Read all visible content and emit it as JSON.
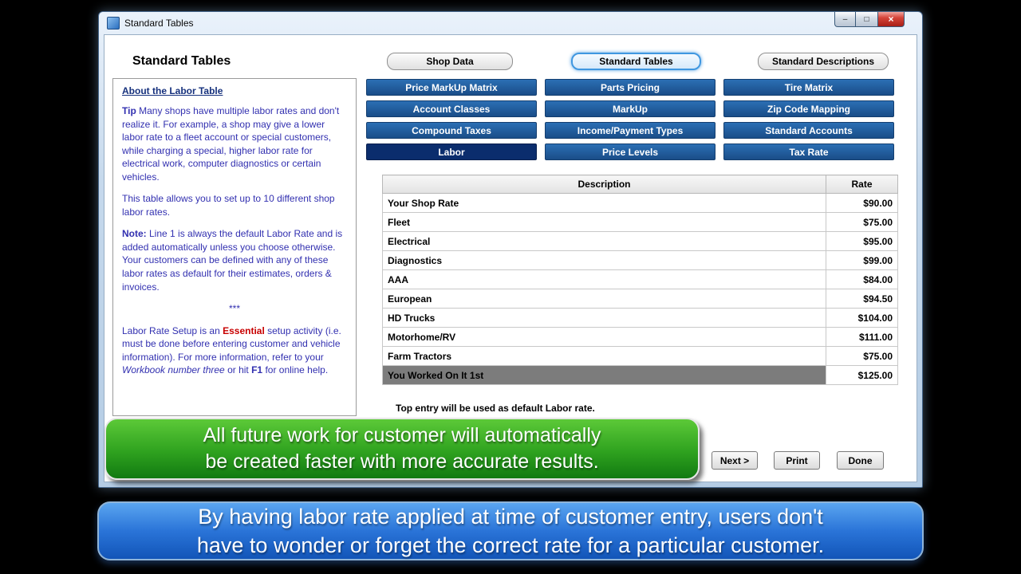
{
  "window": {
    "title": "Standard Tables",
    "heading": "Standard Tables",
    "controls": {
      "minimize": "–",
      "maximize": "□",
      "close": "×"
    }
  },
  "top_tabs": [
    {
      "label": "Shop Data",
      "selected": false
    },
    {
      "label": "Standard Tables",
      "selected": true
    },
    {
      "label": "Standard Descriptions",
      "selected": false
    }
  ],
  "grid_buttons": [
    {
      "label": "Price MarkUp Matrix",
      "selected": false
    },
    {
      "label": "Parts Pricing",
      "selected": false
    },
    {
      "label": "Tire Matrix",
      "selected": false
    },
    {
      "label": "Account Classes",
      "selected": false
    },
    {
      "label": "MarkUp",
      "selected": false
    },
    {
      "label": "Zip Code Mapping",
      "selected": false
    },
    {
      "label": "Compound Taxes",
      "selected": false
    },
    {
      "label": "Income/Payment Types",
      "selected": false
    },
    {
      "label": "Standard Accounts",
      "selected": false
    },
    {
      "label": "Labor",
      "selected": true
    },
    {
      "label": "Price Levels",
      "selected": false
    },
    {
      "label": "Tax Rate",
      "selected": false
    }
  ],
  "about_panel": {
    "header": "About the Labor Table",
    "tip": {
      "label": "Tip",
      "body": " Many shops have multiple labor rates and don't realize it. For example, a shop may give a lower labor rate to a fleet account or special customers, while charging a special, higher labor rate for electrical work, computer diagnostics or certain vehicles."
    },
    "para_allows": "This table allows you to set up to 10 different shop labor rates.",
    "note": {
      "label": "Note:",
      "body": " Line 1 is always the default Labor Rate and is added automatically unless you choose otherwise. Your customers can be defined with any of these labor rates as default for their estimates, orders & invoices."
    },
    "separator": "***",
    "essential_para": {
      "pre": "Labor Rate Setup is an ",
      "essential": "Essential",
      "mid": " setup activity (i.e. must be done before entering customer and vehicle information). For more information, refer to your ",
      "workbook": "Workbook number three",
      "or_hit": " or hit ",
      "f1": "F1",
      "tail": " for online help."
    }
  },
  "labor_table": {
    "headers": {
      "description": "Description",
      "rate": "Rate"
    },
    "rows": [
      {
        "description": "Your Shop Rate",
        "rate": "$90.00",
        "selected": false
      },
      {
        "description": "Fleet",
        "rate": "$75.00",
        "selected": false
      },
      {
        "description": "Electrical",
        "rate": "$95.00",
        "selected": false
      },
      {
        "description": "Diagnostics",
        "rate": "$99.00",
        "selected": false
      },
      {
        "description": "AAA",
        "rate": "$84.00",
        "selected": false
      },
      {
        "description": "European",
        "rate": "$94.50",
        "selected": false
      },
      {
        "description": "HD Trucks",
        "rate": "$104.00",
        "selected": false
      },
      {
        "description": "Motorhome/RV",
        "rate": "$111.00",
        "selected": false
      },
      {
        "description": "Farm Tractors",
        "rate": "$75.00",
        "selected": false
      },
      {
        "description": "You Worked On It 1st",
        "rate": "$125.00",
        "selected": true
      }
    ],
    "footer_note": "Top entry will be used as default Labor rate."
  },
  "action_buttons": {
    "next": "Next >",
    "print": "Print",
    "done": "Done"
  },
  "callouts": {
    "green": {
      "line1": "All future work for customer will automatically",
      "line2": "be created faster with more accurate results."
    },
    "blue": {
      "line1": "By having labor rate applied at time of customer entry, users don't",
      "line2": "have to wonder or forget the correct rate for a particular customer."
    }
  },
  "colors": {
    "category_button_blue": "#1f5c9e",
    "category_selected_navy": "#0b2d6d",
    "selected_tab_glow": "#3f97e0",
    "green_callout": "#2fa21f",
    "blue_callout": "#2a74d8",
    "about_text_purple": "#3230b0",
    "essential_red": "#c80000",
    "selected_row_gray": "#7c7c7c"
  }
}
